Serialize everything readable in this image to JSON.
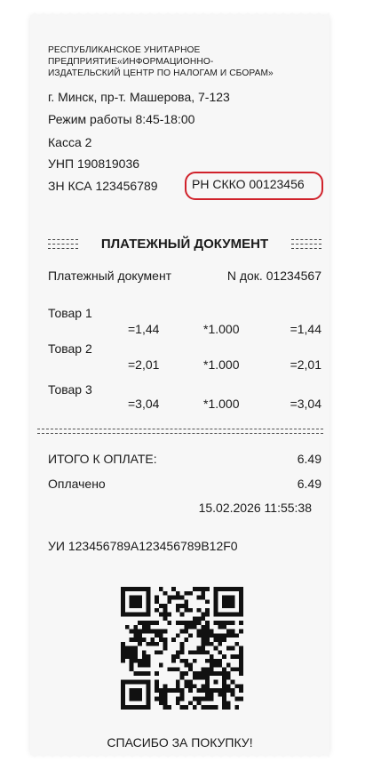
{
  "org_lines": [
    "РЕСПУБЛИКАНСКОЕ УНИТАРНОЕ",
    "ПРЕДПРИЯТИЕ«ИНФОРМАЦИОННО-",
    "ИЗДАТЕЛЬСКИЙ ЦЕНТР ПО НАЛОГАМ И СБОРАМ»"
  ],
  "address": "г. Минск, пр-т. Машерова, 7-123",
  "hours": "Режим работы 8:45-18:00",
  "register": "Касса 2",
  "unp": "УНП 190819036",
  "zn": "ЗН КСА 123456789",
  "rn": "РН СККО 00123456",
  "doc_title": "ПЛАТЕЖНЫЙ ДОКУМЕНТ",
  "doc_type": "Платежный документ",
  "doc_number": "N док. 01234567",
  "items": [
    {
      "name": "Товар 1",
      "price": "=1,44",
      "qty": "*1.000",
      "sum": "=1,44"
    },
    {
      "name": "Товар 2",
      "price": "=2,01",
      "qty": "*1.000",
      "sum": "=2,01"
    },
    {
      "name": "Товар 3",
      "price": "=3,04",
      "qty": "*1.000",
      "sum": "=3,04"
    }
  ],
  "total_label": "ИТОГО К ОПЛАТЕ:",
  "total_value": "6.49",
  "paid_label": "Оплачено",
  "paid_value": "6.49",
  "datetime": "15.02.2026 11:55:38",
  "ui": "УИ 123456789A123456789B12F0",
  "thanks": "СПАСИБО ЗА ПОКУПКУ!",
  "colors": {
    "highlight": "#d0222b",
    "paper": "#f7f7f7"
  },
  "icons": {
    "qr": "qr-code-icon"
  }
}
